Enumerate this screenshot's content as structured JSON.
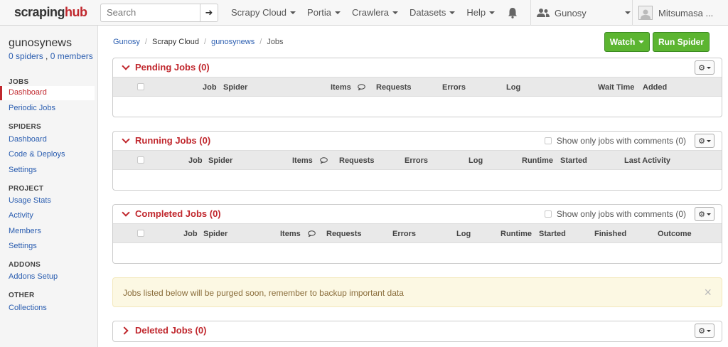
{
  "navbar": {
    "logo_left": "scraping",
    "logo_right": "hub",
    "search_placeholder": "Search",
    "menu": [
      "Scrapy Cloud",
      "Portia",
      "Crawlera",
      "Datasets",
      "Help"
    ],
    "org": "Gunosy",
    "user": "Mitsumasa ..."
  },
  "sidebar": {
    "project_name": "gunosynews",
    "spiders_text": "0 spiders",
    "members_text": "0 members",
    "sections": [
      {
        "title": "JOBS",
        "items": [
          "Dashboard",
          "Periodic Jobs"
        ]
      },
      {
        "title": "SPIDERS",
        "items": [
          "Dashboard",
          "Code & Deploys",
          "Settings"
        ]
      },
      {
        "title": "PROJECT",
        "items": [
          "Usage Stats",
          "Activity",
          "Members",
          "Settings"
        ]
      },
      {
        "title": "ADDONS",
        "items": [
          "Addons Setup"
        ]
      },
      {
        "title": "OTHER",
        "items": [
          "Collections"
        ]
      }
    ]
  },
  "breadcrumb": [
    "Gunosy",
    "Scrapy Cloud",
    "gunosynews",
    "Jobs"
  ],
  "buttons": {
    "watch": "Watch",
    "run_spider": "Run Spider"
  },
  "panels": {
    "pending": {
      "title": "Pending Jobs (0)",
      "columns": [
        "Job",
        "Spider",
        "Items",
        "Requests",
        "Errors",
        "Log",
        "Wait Time",
        "Added"
      ]
    },
    "running": {
      "title": "Running Jobs (0)",
      "filter": "Show only jobs with comments (0)",
      "columns": [
        "Job",
        "Spider",
        "Items",
        "Requests",
        "Errors",
        "Log",
        "Runtime",
        "Started",
        "Last Activity"
      ]
    },
    "completed": {
      "title": "Completed Jobs (0)",
      "filter": "Show only jobs with comments (0)",
      "columns": [
        "Job",
        "Spider",
        "Items",
        "Requests",
        "Errors",
        "Log",
        "Runtime",
        "Started",
        "Finished",
        "Outcome"
      ]
    },
    "deleted": {
      "title": "Deleted Jobs (0)"
    }
  },
  "alert": {
    "text": "Jobs listed below will be purged soon, remember to backup important data",
    "close": "×"
  }
}
